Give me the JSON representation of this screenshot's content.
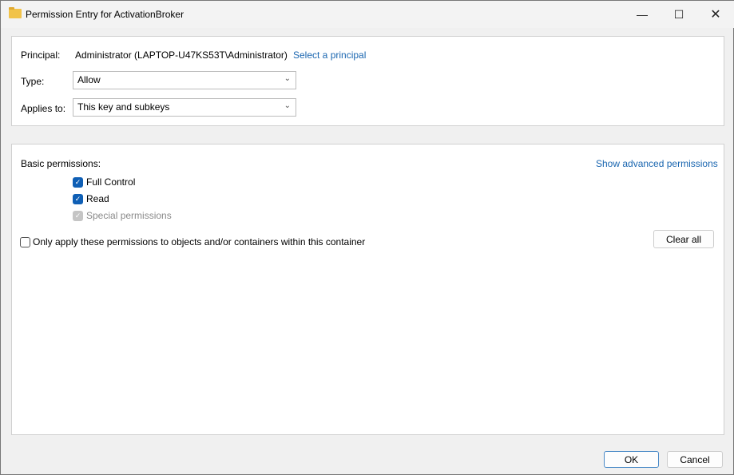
{
  "window": {
    "title": "Permission Entry for ActivationBroker",
    "icon": "folder-icon"
  },
  "principal": {
    "label": "Principal:",
    "value": "Administrator (LAPTOP-U47KS53T\\Administrator)",
    "link": "Select a principal"
  },
  "type": {
    "label": "Type:",
    "value": "Allow"
  },
  "applies": {
    "label": "Applies to:",
    "value": "This key and subkeys"
  },
  "permissions": {
    "label": "Basic permissions:",
    "advanced_link": "Show advanced permissions",
    "items": [
      {
        "label": "Full Control",
        "checked": true
      },
      {
        "label": "Read",
        "checked": true
      },
      {
        "label": "Special permissions",
        "checked": true,
        "disabled": true
      }
    ]
  },
  "only_apply": {
    "label": "Only apply these permissions to objects and/or containers within this container",
    "checked": false
  },
  "clear_all": "Clear all",
  "footer": {
    "ok": "OK",
    "cancel": "Cancel"
  },
  "colors": {
    "accent": "#0f5fb5",
    "link": "#1a66b0"
  }
}
